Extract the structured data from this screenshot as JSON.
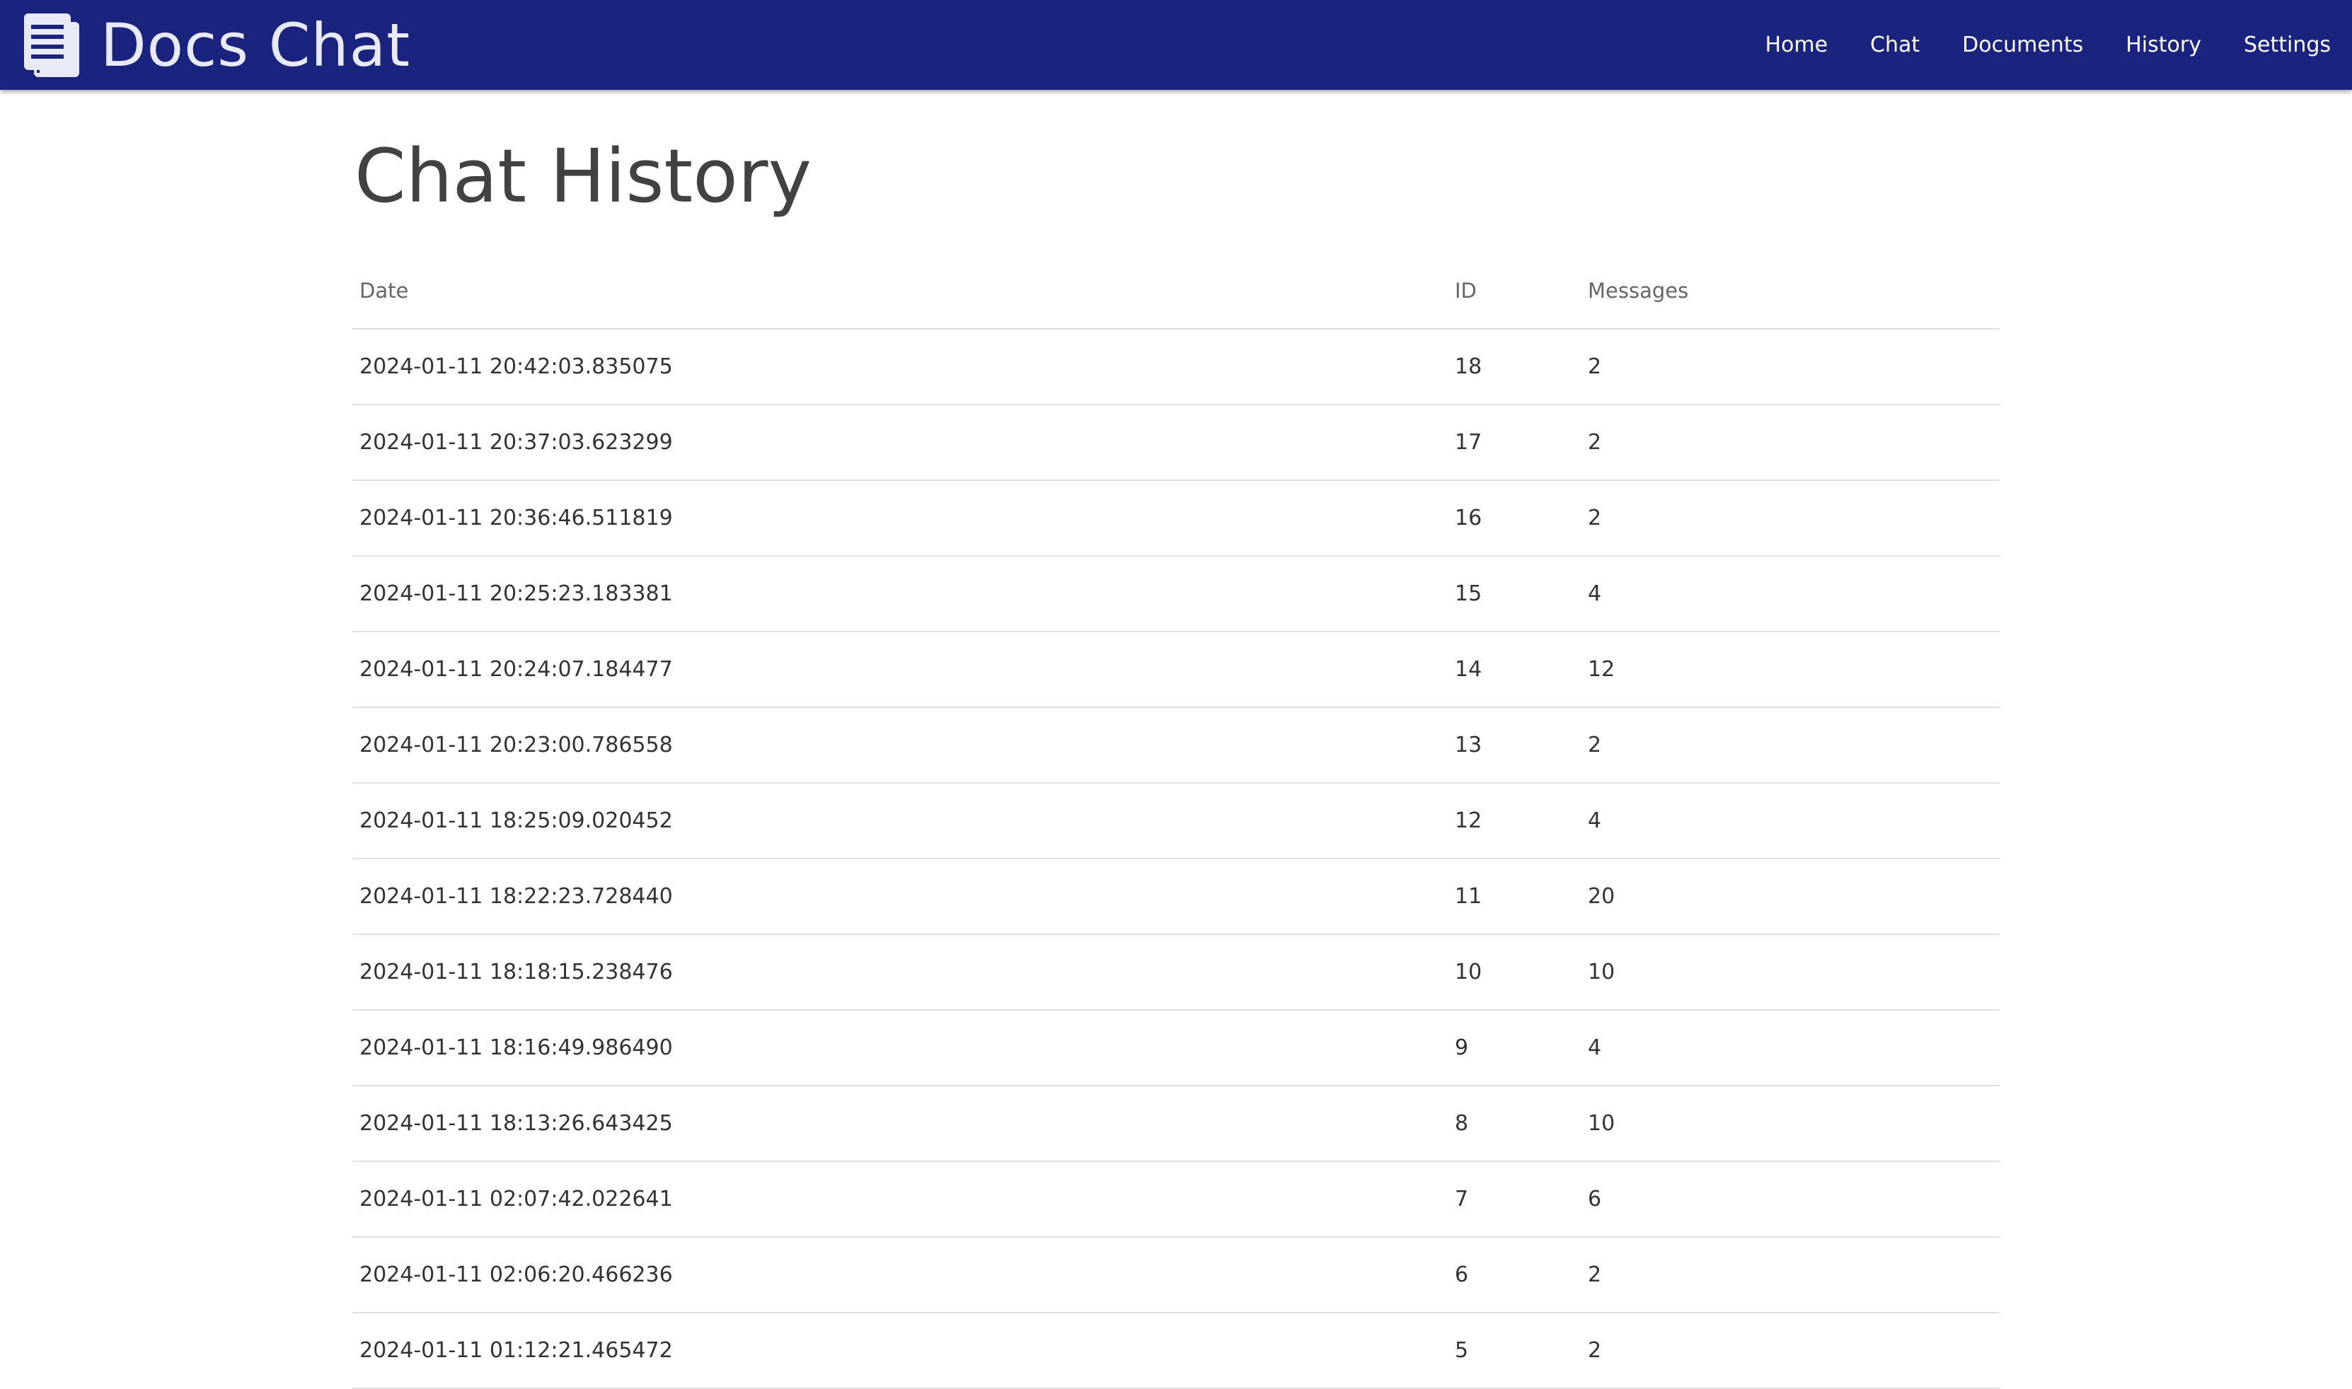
{
  "brand": {
    "title": "Docs Chat",
    "icon": "document-stack-icon"
  },
  "nav": {
    "items": [
      {
        "label": "Home"
      },
      {
        "label": "Chat"
      },
      {
        "label": "Documents"
      },
      {
        "label": "History"
      },
      {
        "label": "Settings"
      }
    ]
  },
  "colors": {
    "navbar_bg": "#1a237e",
    "brand_text": "#e8eaf6",
    "title_text": "#424242",
    "divider": "#e0e0e0"
  },
  "page": {
    "title": "Chat History"
  },
  "table": {
    "headers": {
      "date": "Date",
      "id": "ID",
      "messages": "Messages"
    },
    "rows": [
      {
        "date": "2024-01-11 20:42:03.835075",
        "id": "18",
        "messages": "2"
      },
      {
        "date": "2024-01-11 20:37:03.623299",
        "id": "17",
        "messages": "2"
      },
      {
        "date": "2024-01-11 20:36:46.511819",
        "id": "16",
        "messages": "2"
      },
      {
        "date": "2024-01-11 20:25:23.183381",
        "id": "15",
        "messages": "4"
      },
      {
        "date": "2024-01-11 20:24:07.184477",
        "id": "14",
        "messages": "12"
      },
      {
        "date": "2024-01-11 20:23:00.786558",
        "id": "13",
        "messages": "2"
      },
      {
        "date": "2024-01-11 18:25:09.020452",
        "id": "12",
        "messages": "4"
      },
      {
        "date": "2024-01-11 18:22:23.728440",
        "id": "11",
        "messages": "20"
      },
      {
        "date": "2024-01-11 18:18:15.238476",
        "id": "10",
        "messages": "10"
      },
      {
        "date": "2024-01-11 18:16:49.986490",
        "id": "9",
        "messages": "4"
      },
      {
        "date": "2024-01-11 18:13:26.643425",
        "id": "8",
        "messages": "10"
      },
      {
        "date": "2024-01-11 02:07:42.022641",
        "id": "7",
        "messages": "6"
      },
      {
        "date": "2024-01-11 02:06:20.466236",
        "id": "6",
        "messages": "2"
      },
      {
        "date": "2024-01-11 01:12:21.465472",
        "id": "5",
        "messages": "2"
      }
    ]
  }
}
